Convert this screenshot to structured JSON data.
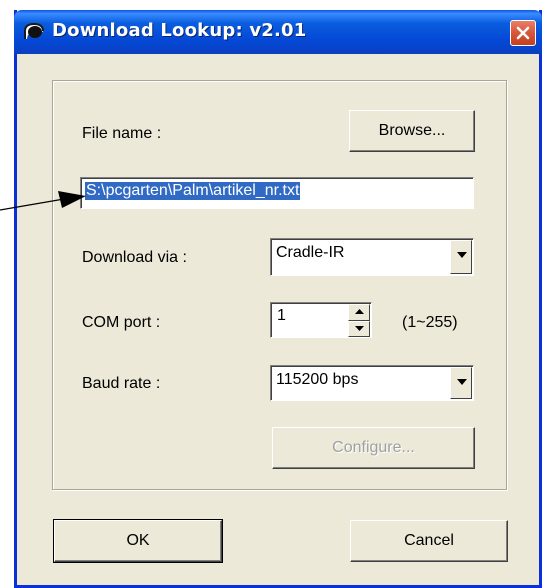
{
  "window": {
    "title": "Download Lookup: v2.01",
    "colors": {
      "titlebar": "#0a5ddf",
      "face": "#ece9d8",
      "selection": "#316ac5",
      "close": "#d9593c"
    }
  },
  "form": {
    "file_name_label": "File name :",
    "browse_label": "Browse...",
    "file_path_value": "S:\\pcgarten\\Palm\\artikel_nr.txt",
    "download_via_label": "Download via :",
    "download_via_value": "Cradle-IR",
    "com_port_label": "COM port :",
    "com_port_value": "1",
    "com_port_range": "(1~255)",
    "baud_rate_label": "Baud rate :",
    "baud_rate_value": "115200 bps",
    "configure_label": "Configure..."
  },
  "footer": {
    "ok_label": "OK",
    "cancel_label": "Cancel"
  },
  "icons": [
    "app-icon",
    "close-icon",
    "chevron-down-icon",
    "spin-up-icon",
    "spin-down-icon",
    "annotation-arrow"
  ]
}
